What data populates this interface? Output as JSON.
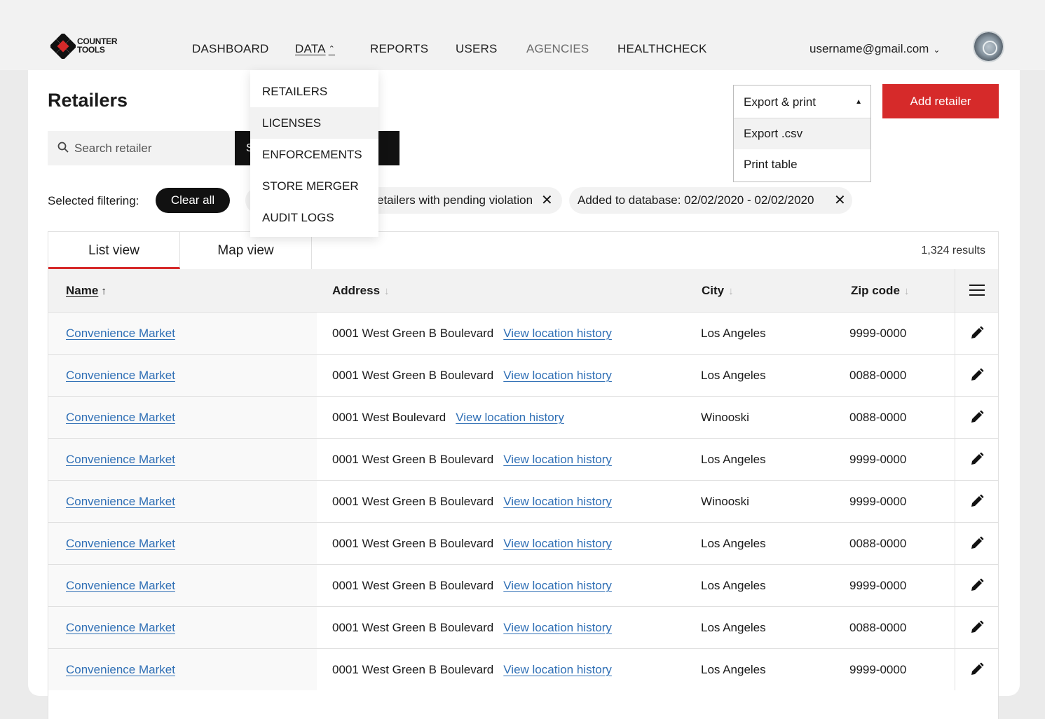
{
  "brand": {
    "line1": "COUNTER",
    "line2": "TOOLS",
    "mark_colors": [
      "#111111",
      "#d62a2a"
    ]
  },
  "nav": {
    "items": [
      {
        "label": "DASHBOARD"
      },
      {
        "label": "DATA",
        "active": true,
        "caret": "^"
      },
      {
        "label": "REPORTS"
      },
      {
        "label": "USERS"
      },
      {
        "label": "AGENCIES",
        "muted": true
      },
      {
        "label": "HEALTHCHECK"
      }
    ],
    "user_email": "username@gmail.com",
    "user_caret": "v"
  },
  "data_menu": {
    "items": [
      "RETAILERS",
      "LICENSES",
      "ENFORCEMENTS",
      "STORE MERGER",
      "AUDIT LOGS"
    ],
    "highlighted": "LICENSES"
  },
  "page": {
    "title": "Retailers"
  },
  "search": {
    "placeholder": "Search retailer",
    "button_label": "S"
  },
  "filters": {
    "label": "Selected filtering:",
    "clear_all": "Clear all",
    "chips": [
      {
        "label": "etailers with pending violation",
        "close": "✕"
      },
      {
        "label": "Added to database: 02/02/2020 - 02/02/2020",
        "close": "✕"
      }
    ]
  },
  "export": {
    "label": "Export & print",
    "options": [
      "Export .csv",
      "Print table"
    ],
    "highlighted": "Export .csv"
  },
  "add_retailer": "Add retailer",
  "results": {
    "tabs": [
      "List view",
      "Map view"
    ],
    "active_tab": "List view",
    "count": "1,324 results",
    "columns": {
      "name": "Name",
      "address": "Address",
      "city": "City",
      "zip": "Zip code"
    },
    "sort": {
      "column": "Name",
      "direction": "ascending"
    },
    "history_link": "View location history",
    "rows": [
      {
        "name": "Convenience Market",
        "address": "0001 West Green B Boulevard",
        "city": "Los Angeles",
        "zip": "9999-0000"
      },
      {
        "name": "Convenience Market",
        "address": "0001 West Green B Boulevard",
        "city": "Los Angeles",
        "zip": "0088-0000"
      },
      {
        "name": "Convenience Market",
        "address": "0001 West Boulevard",
        "city": "Winooski",
        "zip": "0088-0000"
      },
      {
        "name": "Convenience Market",
        "address": "0001 West Green B Boulevard",
        "city": "Los Angeles",
        "zip": "9999-0000"
      },
      {
        "name": "Convenience Market",
        "address": "0001 West Green B Boulevard",
        "city": "Winooski",
        "zip": "9999-0000"
      },
      {
        "name": "Convenience Market",
        "address": "0001 West Green B Boulevard",
        "city": "Los Angeles",
        "zip": "0088-0000"
      },
      {
        "name": "Convenience Market",
        "address": "0001 West Green B Boulevard",
        "city": "Los Angeles",
        "zip": "9999-0000"
      },
      {
        "name": "Convenience Market",
        "address": "0001 West Green B Boulevard",
        "city": "Los Angeles",
        "zip": "0088-0000"
      },
      {
        "name": "Convenience Market",
        "address": "0001 West Green B Boulevard",
        "city": "Los Angeles",
        "zip": "9999-0000"
      }
    ]
  },
  "colors": {
    "accent": "#d62a2a",
    "link": "#2f6fb5",
    "dark": "#111111",
    "panel": "#f2f2f2"
  },
  "icons": {
    "search": "search-icon",
    "edit": "pencil-icon",
    "columns": "menu-icon",
    "close": "close-icon"
  }
}
